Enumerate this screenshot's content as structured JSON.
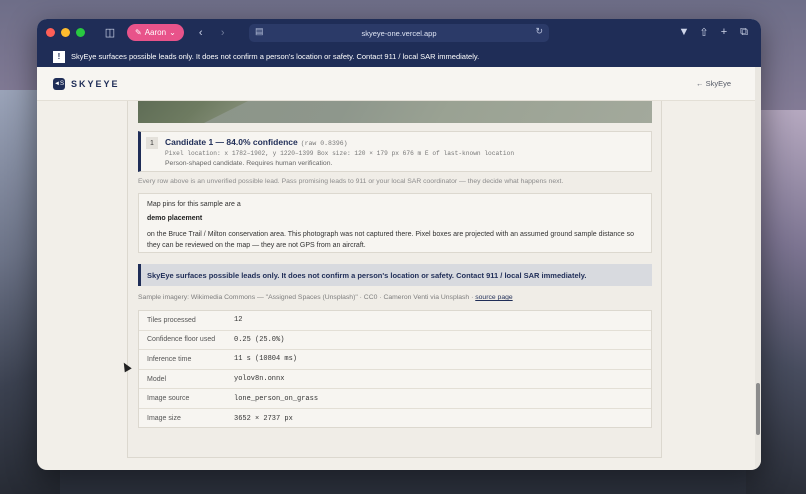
{
  "browser": {
    "profile_label": "Aaron",
    "url": "skyeye-one.vercel.app"
  },
  "banner": {
    "badge": "!",
    "text": "SkyEye surfaces possible leads only. It does not confirm a person's location or safety. Contact 911 / local SAR immediately."
  },
  "site": {
    "logo_mark": "◄S",
    "logo_text": "SKYEYE",
    "back_link": "← SkyEye"
  },
  "candidate": {
    "number": "1",
    "title": "Candidate 1 — 84.0% confidence",
    "raw": "(raw 0.8396)",
    "meta": "Pixel location: x 1782–1902, y 1220–1399   Box size: 120 × 179 px   676 m E of last-known location",
    "note": "Person-shaped candidate. Requires human verification."
  },
  "disclaimer": "Every row above is an unverified possible lead. Pass promising leads to 911 or your local SAR coordinator — they decide what happens next.",
  "map_note": {
    "intro": "Map pins for this sample are a",
    "strong": "demo placement",
    "body": "on the Bruce Trail / Milton conservation area. This photograph was not captured there. Pixel boxes are projected with an assumed ground sample distance so they can be reviewed on the map — they are not GPS from an aircraft."
  },
  "warning": "SkyEye surfaces possible leads only. It does not confirm a person's location or safety. Contact 911 / local SAR immediately.",
  "credit": {
    "text": "Sample imagery: Wikimedia Commons — \"Assigned Spaces (Unsplash)\" · CC0 · Cameron Venti via Unsplash ·",
    "link": "source page"
  },
  "stats": [
    {
      "label": "Tiles processed",
      "value": "12"
    },
    {
      "label": "Confidence floor used",
      "value": "0.25 (25.0%)"
    },
    {
      "label": "Inference time",
      "value": "11 s (10804 ms)"
    },
    {
      "label": "Model",
      "value": "yolov8n.onnx"
    },
    {
      "label": "Image source",
      "value": "lone_person_on_grass"
    },
    {
      "label": "Image size",
      "value": "3652 × 2737 px"
    }
  ]
}
